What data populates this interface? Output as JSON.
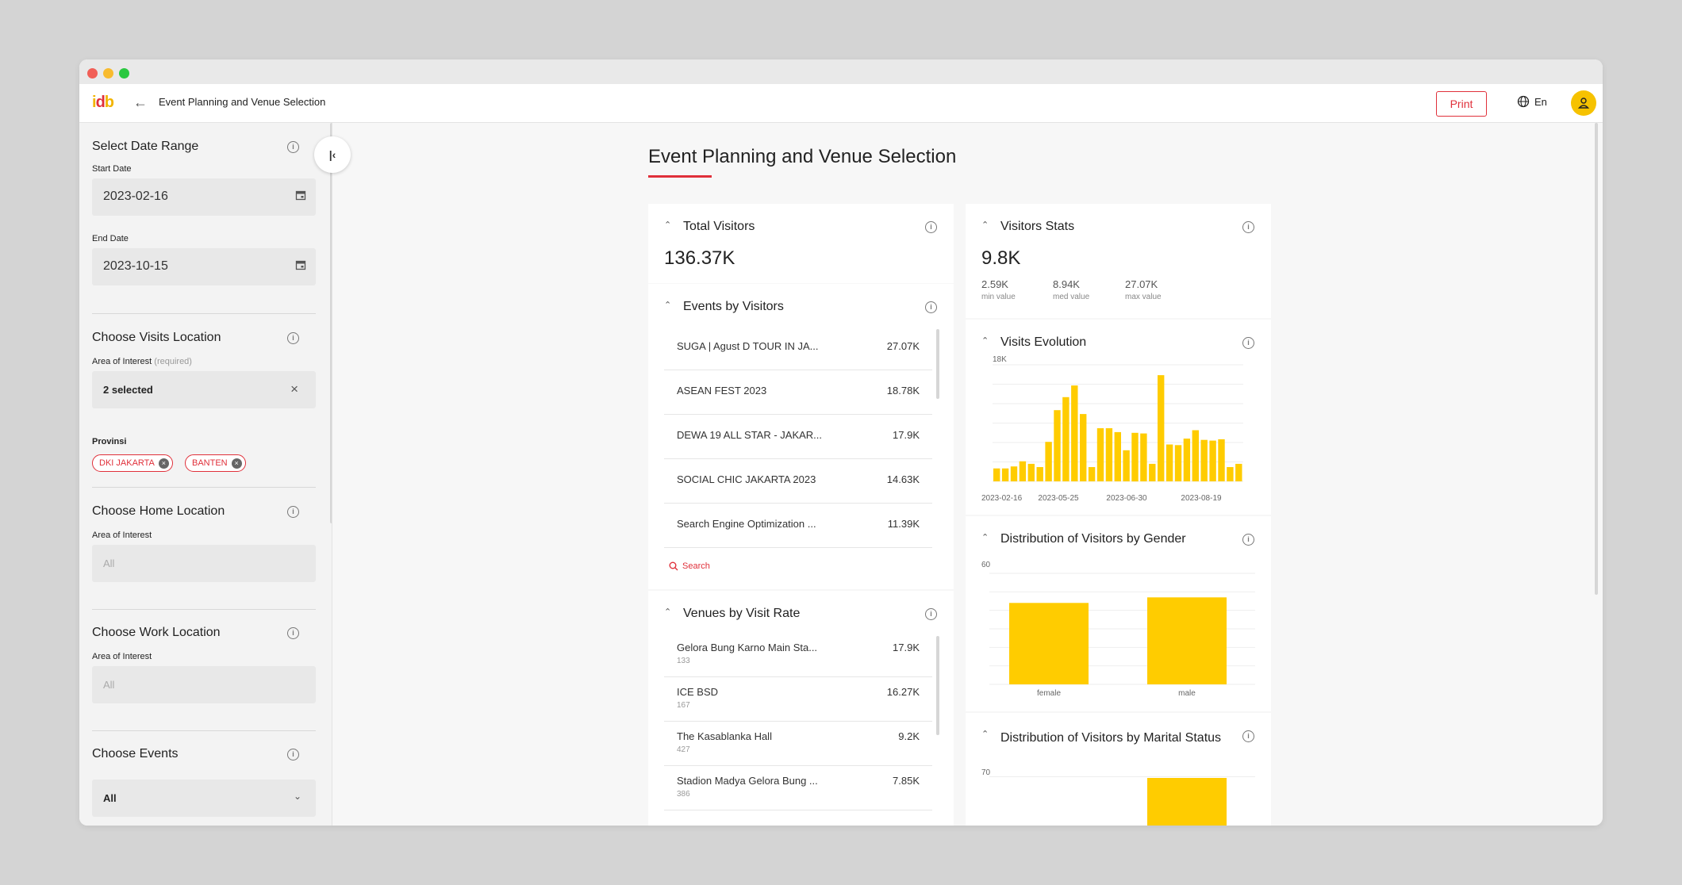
{
  "app": {
    "breadcrumb": "Event Planning and Venue Selection",
    "print_label": "Print",
    "language": "En"
  },
  "sidebar": {
    "date_range": {
      "title": "Select Date Range",
      "start_label": "Start Date",
      "start_value": "2023-02-16",
      "end_label": "End Date",
      "end_value": "2023-10-15"
    },
    "visits": {
      "title": "Choose Visits Location",
      "aoi_label": "Area of Interest",
      "aoi_required": "(required)",
      "selected": "2 selected",
      "provinsi_label": "Provinsi",
      "chips": [
        "DKI JAKARTA",
        "BANTEN"
      ]
    },
    "home": {
      "title": "Choose Home Location",
      "aoi_label": "Area of Interest",
      "value": "All"
    },
    "work": {
      "title": "Choose Work Location",
      "aoi_label": "Area of Interest",
      "value": "All"
    },
    "events": {
      "title": "Choose Events",
      "value": "All"
    }
  },
  "page": {
    "title": "Event Planning and Venue Selection"
  },
  "total_visitors": {
    "title": "Total Visitors",
    "value": "136.37K"
  },
  "events_by_visitors": {
    "title": "Events by Visitors",
    "rows": [
      {
        "name": "SUGA | Agust D TOUR IN JA...",
        "value": "27.07K"
      },
      {
        "name": "ASEAN FEST 2023",
        "value": "18.78K"
      },
      {
        "name": "DEWA 19 ALL STAR - JAKAR...",
        "value": "17.9K"
      },
      {
        "name": "SOCIAL CHIC JAKARTA 2023",
        "value": "14.63K"
      },
      {
        "name": "Search Engine Optimization ...",
        "value": "11.39K"
      }
    ],
    "search_label": "Search"
  },
  "venues_by_visit_rate": {
    "title": "Venues by Visit Rate",
    "rows": [
      {
        "name": "Gelora Bung Karno Main Sta...",
        "sub": "133",
        "value": "17.9K"
      },
      {
        "name": "ICE BSD",
        "sub": "167",
        "value": "16.27K"
      },
      {
        "name": "The Kasablanka Hall",
        "sub": "427",
        "value": "9.2K"
      },
      {
        "name": "Stadion Madya Gelora Bung ...",
        "sub": "386",
        "value": "7.85K"
      }
    ]
  },
  "visitors_stats": {
    "title": "Visitors Stats",
    "value": "9.8K",
    "stats": [
      {
        "value": "2.59K",
        "label": "min value"
      },
      {
        "value": "8.94K",
        "label": "med value"
      },
      {
        "value": "27.07K",
        "label": "max value"
      }
    ]
  },
  "visits_evolution": {
    "title": "Visits Evolution"
  },
  "gender": {
    "title": "Distribution of Visitors by Gender"
  },
  "marital": {
    "title": "Distribution of Visitors by Marital Status",
    "ytick": "70"
  },
  "colors": {
    "accent": "#e0303a",
    "bar": "#ffcc00"
  },
  "chart_data": [
    {
      "type": "bar",
      "ylabel_tick": "18K",
      "ylim": [
        0,
        18000
      ],
      "x_tick_labels": [
        "2023-02-16",
        "2023-05-25",
        "2023-06-30",
        "2023-08-19"
      ],
      "values": [
        2000,
        2000,
        2300,
        3100,
        2700,
        2200,
        6100,
        11000,
        13000,
        14800,
        10400,
        2200,
        8200,
        8200,
        7600,
        4800,
        7500,
        7400,
        2700,
        16400,
        5700,
        5600,
        6600,
        7900,
        6400,
        6300,
        6500,
        2200,
        2700
      ]
    },
    {
      "type": "bar",
      "categories": [
        "female",
        "male"
      ],
      "values": [
        44,
        47
      ],
      "ylabel_tick": "60",
      "ylim": [
        0,
        60
      ]
    }
  ]
}
